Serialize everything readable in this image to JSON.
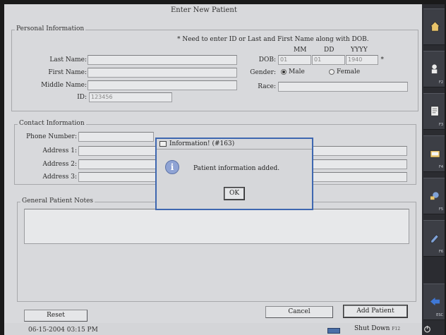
{
  "window": {
    "title": "Enter New Patient"
  },
  "personal": {
    "group_label": "Personal Information",
    "note": "* Need to enter ID or Last and First Name along with DOB.",
    "last_name_label": "Last Name:",
    "first_name_label": "First Name:",
    "middle_name_label": "Middle Name:",
    "id_label": "ID:",
    "id_value": "123456",
    "dob_label": "DOB:",
    "dob_headers": {
      "mm": "MM",
      "dd": "DD",
      "yyyy": "YYYY"
    },
    "dob_mm": "01",
    "dob_dd": "01",
    "dob_yyyy": "1940",
    "dob_req": "*",
    "gender_label": "Gender:",
    "gender_male": "Male",
    "gender_female": "Female",
    "gender_selected": "Male",
    "race_label": "Race:"
  },
  "contact": {
    "group_label": "Contact Information",
    "phone_label": "Phone Number:",
    "address1_label": "Address 1:",
    "address2_label": "Address 2:",
    "address3_label": "Address 3:"
  },
  "notes": {
    "group_label": "General Patient Notes"
  },
  "buttons": {
    "reset": "Reset",
    "cancel": "Cancel",
    "add_patient": "Add Patient"
  },
  "dialog": {
    "title": "Information! (#163)",
    "message": "Patient information added.",
    "ok": "OK"
  },
  "status": {
    "datetime": "06-15-2004 03:15 PM",
    "shutdown_label": "Shut Down",
    "shutdown_key": "F12"
  },
  "sidebar": [
    {
      "icon": "home-icon",
      "key": ""
    },
    {
      "icon": "patient-search-icon",
      "key": "F2"
    },
    {
      "icon": "report-icon",
      "key": "F3"
    },
    {
      "icon": "folder-icon",
      "key": "F4"
    },
    {
      "icon": "settings-icon",
      "key": "F5"
    },
    {
      "icon": "edit-icon",
      "key": "F6"
    },
    {
      "icon": "back-arrow-icon",
      "key": "ESC"
    }
  ],
  "colors": {
    "dialog_border": "#3e67b0",
    "sidebar_bg": "#2b2c31",
    "background": "#d8d9dc"
  }
}
